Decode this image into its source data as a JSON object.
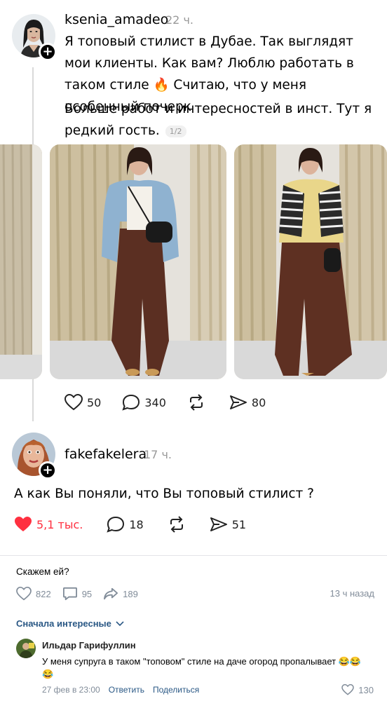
{
  "post": {
    "username": "ksenia_amadeo",
    "time": "22 ч.",
    "paragraph1": "Я топовый стилист в Дубае. Так выглядят мои клиенты. Как вам? Люблю работать в таком стиле 🔥 Считаю, что у меня особенный почерк",
    "paragraph2": "Больше работ и интересностей в инст. Тут я редкий гость.",
    "page_indicator": "1/2",
    "likes": "50",
    "comments": "340",
    "reposts": "",
    "shares": "80"
  },
  "reply": {
    "username": "fakefakelera",
    "time": "17 ч.",
    "text": "А как Вы поняли, что Вы топовый стилист ?",
    "likes": "5,1 тыс.",
    "comments": "18",
    "shares": "51",
    "liked_color": "#ff3040"
  },
  "vk": {
    "caption": "Скажем ей?",
    "likes": "822",
    "comments": "95",
    "shares": "189",
    "time": "13 ч назад",
    "sort_label": "Сначала интересные",
    "comment": {
      "author": "Ильдар Гарифуллин",
      "text": "У меня супруга в таком \"топовом\" стиле на даче огород пропалывает 😂😂😂",
      "date": "27 фев в 23:00",
      "reply_label": "Ответить",
      "share_label": "Поделиться",
      "likes": "130"
    },
    "link_color": "#2a5885",
    "meta_color": "#818c99"
  }
}
